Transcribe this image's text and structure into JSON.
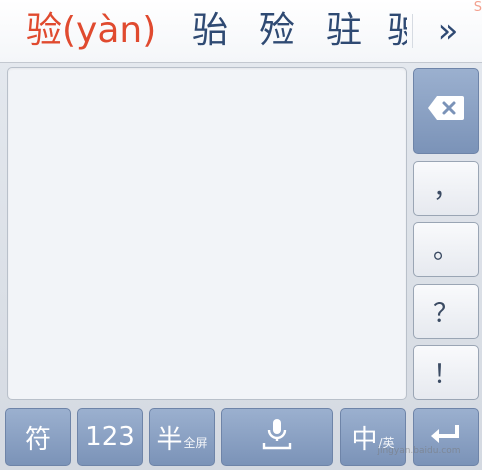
{
  "candidates": {
    "primary": "验(yàn)",
    "others": [
      "骀",
      "殓",
      "驻",
      "驶"
    ],
    "more_glyph": "»",
    "corner_mark": "S"
  },
  "side_keys": {
    "comma": "，",
    "period": "。",
    "question": "？",
    "exclaim": "！"
  },
  "bottom_row": {
    "symbols": "符",
    "numbers": "123",
    "half": "半",
    "fullscreen": "全屏",
    "lang": "中",
    "lang_sub": "/英"
  },
  "watermark": {
    "text": "jingyan.baidu.com"
  },
  "icons": {
    "backspace": "backspace-icon",
    "voice": "microphone-icon",
    "enter": "enter-icon"
  },
  "colors": {
    "primary_candidate": "#e04a2f",
    "candidate": "#2f4a73",
    "key_blue": "#8aa0c4",
    "pad": "#f2f4f8"
  }
}
